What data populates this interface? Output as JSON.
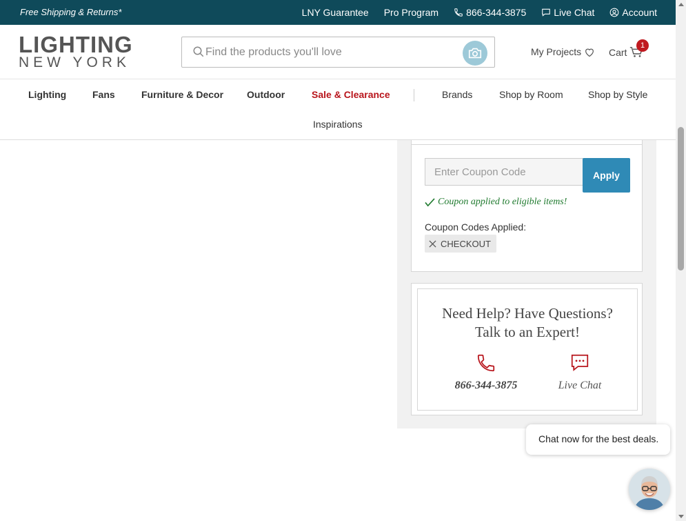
{
  "topbar": {
    "promo": "Free Shipping & Returns*",
    "guarantee": "LNY Guarantee",
    "pro_program": "Pro Program",
    "phone": "866-344-3875",
    "live_chat": "Live Chat",
    "account": "Account",
    "bg_color": "#0f4a5a"
  },
  "header": {
    "logo_line1": "LIGHTING",
    "logo_line2": "NEW YORK",
    "search_placeholder": "Find the products you'll love",
    "my_projects": "My Projects",
    "cart": "Cart",
    "cart_count": "1"
  },
  "nav": {
    "items": [
      "Lighting",
      "Fans",
      "Furniture & Decor",
      "Outdoor",
      "Sale & Clearance",
      "Brands",
      "Shop by Room",
      "Shop by Style",
      "Inspirations"
    ],
    "sale_color": "#b8141b"
  },
  "coupon": {
    "placeholder": "Enter Coupon Code",
    "apply": "Apply",
    "message": "Coupon applied to eligible items!",
    "applied_label": "Coupon Codes Applied:",
    "code": "CHECKOUT",
    "accent": "#2f8ab6"
  },
  "help": {
    "title_line1": "Need Help? Have Questions?",
    "title_line2": "Talk to an Expert!",
    "phone": "866-344-3875",
    "chat": "Live Chat",
    "icon_color": "#b8141b"
  },
  "chat_widget": {
    "bubble": "Chat now for the best deals."
  }
}
